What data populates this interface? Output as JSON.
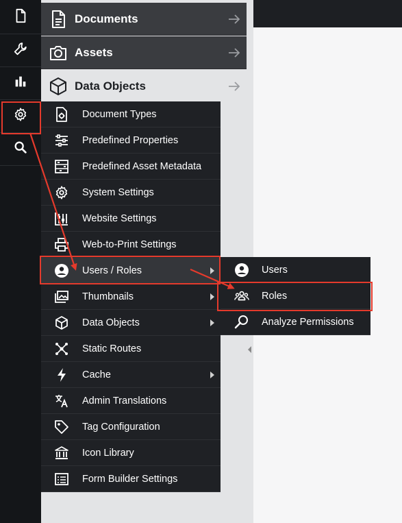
{
  "left_nav": [
    {
      "name": "document-icon"
    },
    {
      "name": "wrench-icon"
    },
    {
      "name": "bar-chart-icon"
    },
    {
      "name": "gear-icon"
    },
    {
      "name": "search-icon"
    }
  ],
  "tree": {
    "documents": "Documents",
    "assets": "Assets",
    "data_objects": "Data Objects"
  },
  "settings_menu": {
    "items": [
      {
        "label": "Document Types",
        "icon": "document-gear-icon"
      },
      {
        "label": "Predefined Properties",
        "icon": "sliders-icon"
      },
      {
        "label": "Predefined Asset Metadata",
        "icon": "metadata-icon"
      },
      {
        "label": "System Settings",
        "icon": "gear-icon"
      },
      {
        "label": "Website Settings",
        "icon": "website-settings-icon"
      },
      {
        "label": "Web-to-Print Settings",
        "icon": "printer-icon"
      },
      {
        "label": "Users / Roles",
        "icon": "user-circle-icon",
        "submenu": true,
        "active": true
      },
      {
        "label": "Thumbnails",
        "icon": "images-icon",
        "submenu": true
      },
      {
        "label": "Data Objects",
        "icon": "cube-icon",
        "submenu": true
      },
      {
        "label": "Static Routes",
        "icon": "routes-icon"
      },
      {
        "label": "Cache",
        "icon": "lightning-icon",
        "submenu": true
      },
      {
        "label": "Admin Translations",
        "icon": "translate-icon"
      },
      {
        "label": "Tag Configuration",
        "icon": "tag-icon"
      },
      {
        "label": "Icon Library",
        "icon": "library-icon"
      },
      {
        "label": "Form Builder Settings",
        "icon": "form-icon"
      }
    ]
  },
  "users_roles_submenu": {
    "items": [
      {
        "label": "Users",
        "icon": "user-circle-icon"
      },
      {
        "label": "Roles",
        "icon": "roles-group-icon"
      },
      {
        "label": "Analyze Permissions",
        "icon": "magnifier-icon"
      }
    ]
  },
  "colors": {
    "sidebar_bg": "#141619",
    "menu_bg": "#1f2125",
    "highlight": "#e53a2c"
  }
}
